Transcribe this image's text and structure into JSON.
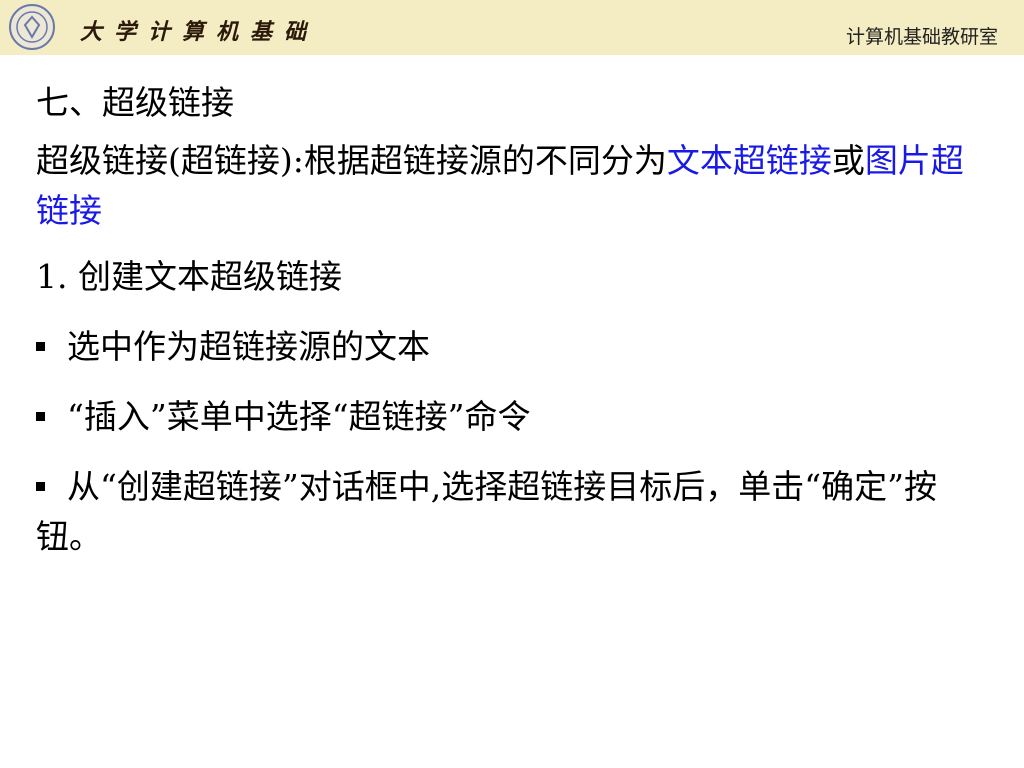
{
  "header": {
    "brand": "大学计算机基础",
    "department": "计算机基础教研室",
    "colors": {
      "banner": "#f4ecc3",
      "link": "#1a1ae6"
    }
  },
  "content": {
    "heading": "七、超级链接",
    "intro": {
      "part1": "超级链接(超链接):根据超链接源的不同分为",
      "link1": "文本超链接",
      "part2": "或",
      "link2": "图片超链接"
    },
    "subheading": "1. 创建文本超级链接",
    "bullets": [
      "选中作为超链接源的文本",
      "“插入”菜单中选择“超链接”命令",
      "从“创建超链接”对话框中,选择超链接目标后，单击“确定”按钮。"
    ]
  }
}
